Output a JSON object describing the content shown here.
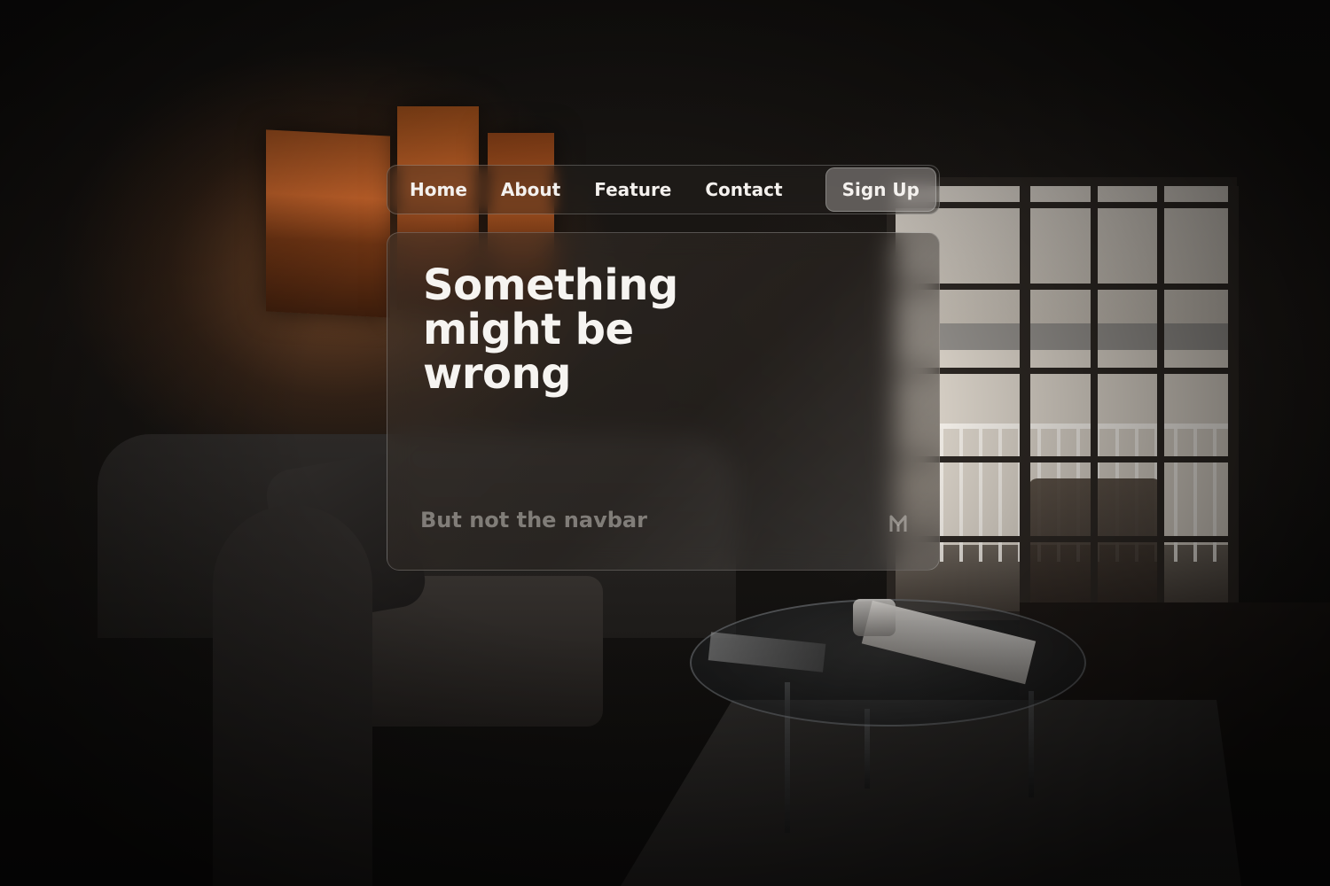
{
  "navbar": {
    "items": [
      {
        "label": "Home"
      },
      {
        "label": "About"
      },
      {
        "label": "Feature"
      },
      {
        "label": "Contact"
      }
    ],
    "signup_label": "Sign Up"
  },
  "hero": {
    "title": "Something might be wrong",
    "subtitle": "But not the navbar",
    "logo_icon": "m-logo-icon"
  },
  "colors": {
    "text_primary": "#f6f4f1",
    "text_muted": "#c8c4c0",
    "glass_border": "#ffffff"
  }
}
